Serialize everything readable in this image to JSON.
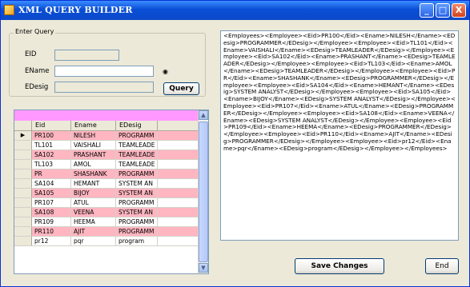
{
  "window": {
    "title": "XML QUERY BUILDER",
    "controls": {
      "minimize": "_",
      "maximize": "□",
      "close": "X"
    }
  },
  "query_group": {
    "title": "Enter Query",
    "eid_label": "EID",
    "eid_value": "",
    "ename_label": "EName",
    "ename_value": "",
    "edesig_label": "EDesig",
    "edesig_value": "",
    "query_button": "Query"
  },
  "grid": {
    "columns": [
      "Eid",
      "Ename",
      "EDesig"
    ],
    "current_row_marker": "▶",
    "rows": [
      {
        "eid": "PR100",
        "ename": "NILESH",
        "edesig": "PROGRAMM",
        "style": "pink",
        "current": true
      },
      {
        "eid": "TL101",
        "ename": "VAISHALI",
        "edesig": "TEAMLEADE",
        "style": "white"
      },
      {
        "eid": "SA102",
        "ename": "PRASHANT",
        "edesig": "TEAMLEADE",
        "style": "pink"
      },
      {
        "eid": "TL103",
        "ename": "AMOL",
        "edesig": "TEAMLEADE",
        "style": "white"
      },
      {
        "eid": "PR",
        "ename": "SHASHANK",
        "edesig": "PROGRAMM",
        "style": "pink"
      },
      {
        "eid": "SA104",
        "ename": "HEMANT",
        "edesig": "SYSTEM AN",
        "style": "white"
      },
      {
        "eid": "SA105",
        "ename": "BIJOY",
        "edesig": "SYSTEM AN",
        "style": "pink"
      },
      {
        "eid": "PR107",
        "ename": "ATUL",
        "edesig": "PROGRAMM",
        "style": "white"
      },
      {
        "eid": "SA108",
        "ename": "VEENA",
        "edesig": "SYSTEM AN",
        "style": "pink"
      },
      {
        "eid": "PR109",
        "ename": "HEEMA",
        "edesig": "PROGRAMM",
        "style": "white"
      },
      {
        "eid": "PR110",
        "ename": "AJIT",
        "edesig": "PROGRAMM",
        "style": "pink"
      },
      {
        "eid": "pr12",
        "ename": "pqr",
        "edesig": "program",
        "style": "white"
      }
    ],
    "scroll_up": "▲",
    "scroll_down": "▼"
  },
  "xml_output": "<Employees><Employee><Eid>PR100</Eid><Ename>NILESH</Ename><EDesig>PROGRAMMER</EDesig></Employee><Employee><Eid>TL101</Eid><Ename>VAISHALI</Ename><EDesig>TEAMLEADER</EDesig></Employee><Employee><Eid>SA102</Eid><Ename>PRASHANT</Ename><EDesig>TEAMLEADER</EDesig></Employee><Employee><Eid>TL103</Eid><Ename>AMOL</Ename><EDesig>TEAMLEADER</EDesig></Employee><Employee><Eid>PR</Eid><Ename>SHASHANK</Ename><EDesig>PROGRAMMER</EDesig></Employee><Employee><Eid>SA104</Eid><Ename>HEMANT</Ename><EDesig>SYSTEM ANALYST</EDesig></Employee><Employee><Eid>SA105</Eid><Ename>BIJOY</Ename><EDesig>SYSTEM ANALYST</EDesig></Employee><Employee><Eid>PR107</Eid><Ename>ATUL</Ename><EDesig>PROGRAMMER</EDesig></Employee><Employee><Eid>SA108</Eid><Ename>VEENA</Ename><EDesig>SYSTEM ANALYST</EDesig></Employee><Employee><Eid>PR109</Eid><Ename>HEEMA</Ename><EDesig>PROGRAMMER</EDesig></Employee><Employee><Eid>PR110</Eid><Ename>AJIT</Ename><EDesig>PROGRAMMER</EDesig></Employee><Employee><Eid>pr12</Eid><Ename>pqr</Ename><EDesig>program</EDesig></Employee></Employees>",
  "buttons": {
    "save_changes": "Save Changes",
    "end": "End"
  },
  "colors": {
    "title_bar": "#0a4fd6",
    "grid_caption": "#ff99ff",
    "row_highlight": "#ffb6c1"
  }
}
